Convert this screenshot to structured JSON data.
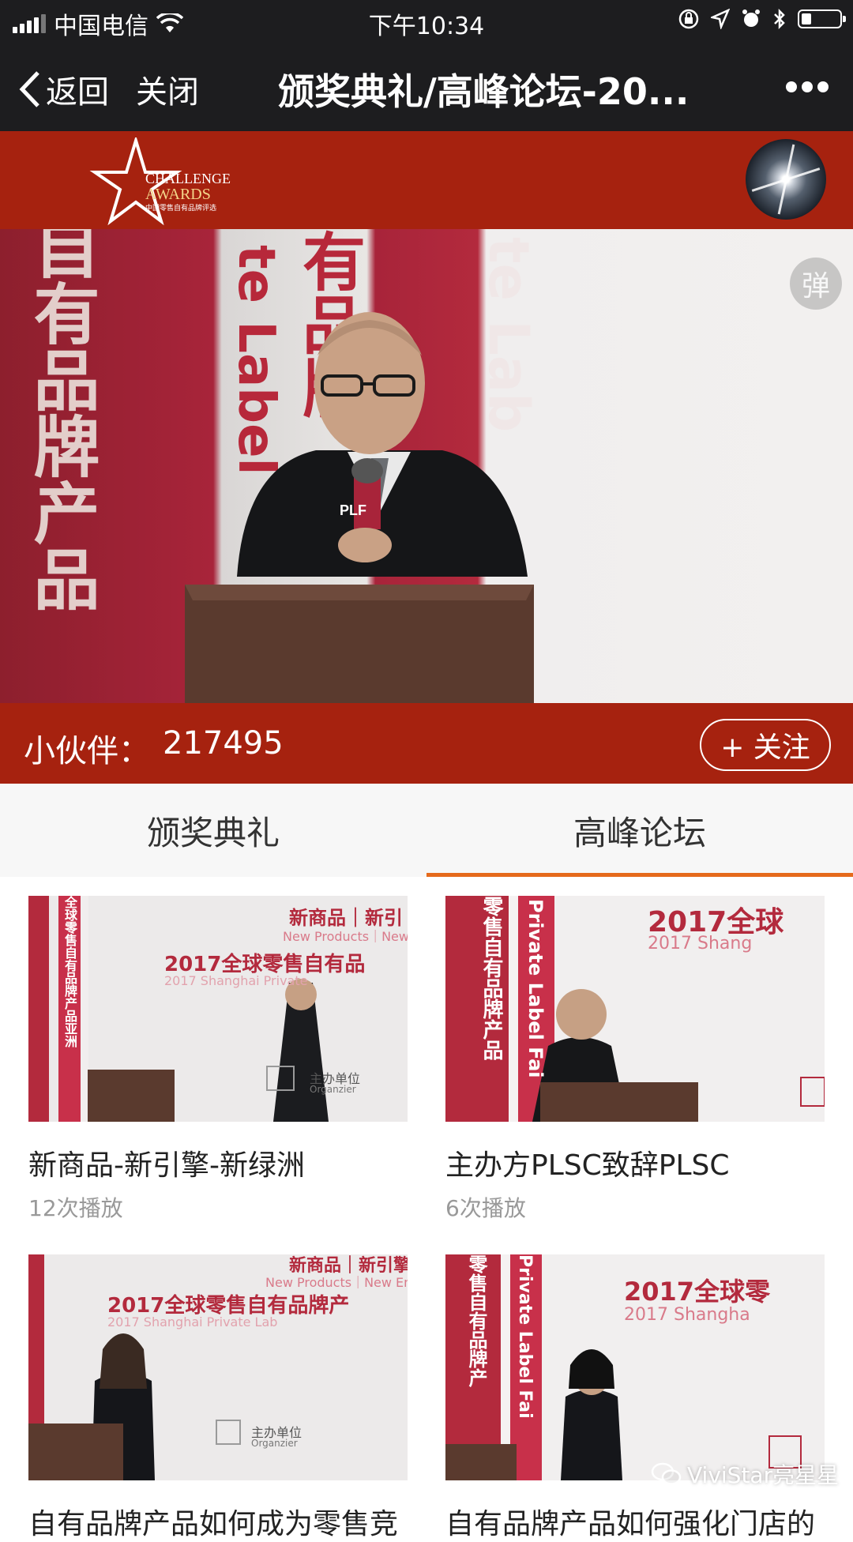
{
  "status_bar": {
    "carrier": "中国电信",
    "time": "下午10:34",
    "battery_level": 0.25
  },
  "nav": {
    "back_label": "返回",
    "close_label": "关闭",
    "title": "颁奖典礼/高峰论坛-20..."
  },
  "banner": {
    "logo_text_1": "CHALLENGE",
    "logo_text_2": "AWARDS",
    "logo_text_3": "中国零售自有品牌评选"
  },
  "player": {
    "danmu_label": "弹",
    "banner_left_text": "自有品牌产品",
    "banner_mid_text": "有品牌",
    "banner_mid2_text": "te Label",
    "banner_right_text": "te Lab",
    "podium_brand": "PLF"
  },
  "follow_bar": {
    "label": "小伙伴：",
    "count": "217495",
    "follow_label": "+ 关注"
  },
  "tabs": [
    {
      "label": "颁奖典礼",
      "active": false
    },
    {
      "label": "高峰论坛",
      "active": true
    }
  ],
  "videos": [
    {
      "title": "新商品-新引擎-新绿洲",
      "plays": "12次播放",
      "thumb_head": "新商品｜新引",
      "thumb_sub": "New Products｜New",
      "thumb_main": "2017全球零售自有品",
      "thumb_en": "2017 Shanghai Private",
      "thumb_side": "全球零售自有品牌产品亚洲",
      "thumb_org": "主办单位",
      "thumb_org_en": "Organzier"
    },
    {
      "title": "主办方PLSC致辞PLSC",
      "plays": "6次播放",
      "thumb_head": "2017全球",
      "thumb_sub": "2017 Shang",
      "thumb_side": "零售自有品牌产品",
      "thumb_side2": "Private Label Fai"
    },
    {
      "title": "自有品牌产品如何成为零售竞",
      "thumb_head": "新商品｜新引擎",
      "thumb_sub": "New Products｜New Engi",
      "thumb_main": "2017全球零售自有品牌产",
      "thumb_en": "2017 Shanghai Private Lab",
      "thumb_org": "主办单位",
      "thumb_org_en": "Organzier"
    },
    {
      "title": "自有品牌产品如何强化门店的",
      "thumb_head": "2017全球零",
      "thumb_sub": "2017 Shangha",
      "thumb_side": "零售自有品牌产",
      "thumb_side2": "Private Label Fai"
    }
  ],
  "watermark": "ViviStar亮星星",
  "colors": {
    "brand_red": "#a6220f",
    "nav_dark": "#1d1d1f",
    "tab_underline": "#e56a1c"
  }
}
